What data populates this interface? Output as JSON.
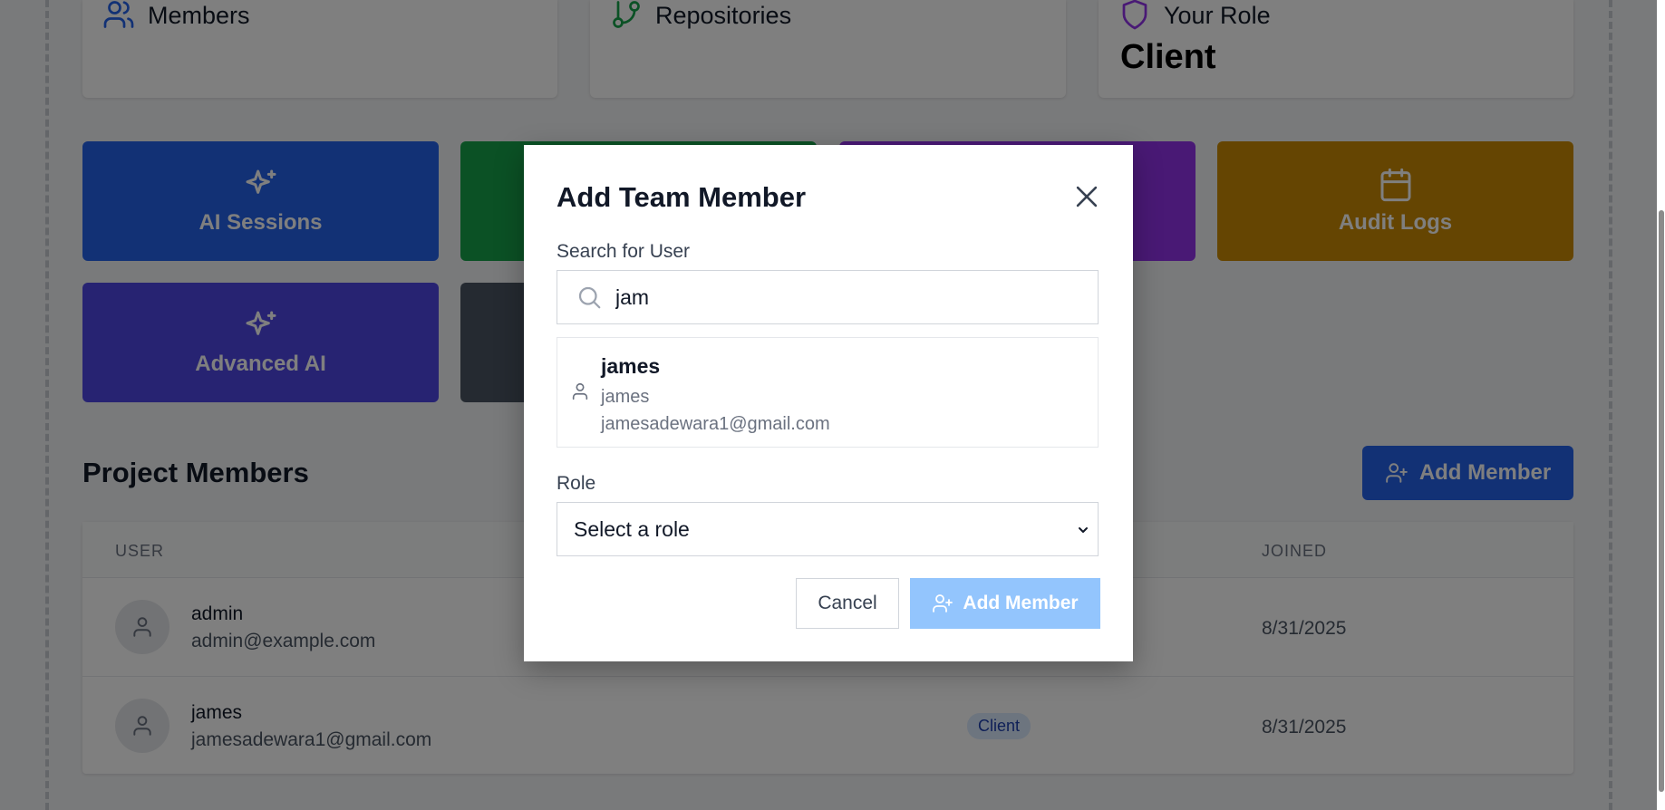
{
  "stats": [
    {
      "title": "Members",
      "icon": "users-icon",
      "value": ""
    },
    {
      "title": "Repositories",
      "icon": "git-branch-icon",
      "value": ""
    },
    {
      "title": "Your Role",
      "icon": "shield-icon",
      "value": "Client"
    }
  ],
  "actions": [
    {
      "label": "AI Sessions",
      "icon": "sparkles-icon",
      "color": "#2563eb"
    },
    {
      "label": "",
      "icon": "",
      "color": "#16a34a"
    },
    {
      "label": "",
      "icon": "",
      "color": "#9333ea"
    },
    {
      "label": "Audit Logs",
      "icon": "calendar-icon",
      "color": "#ca8a04"
    },
    {
      "label": "Advanced AI",
      "icon": "sparkles-icon",
      "color": "#4f46e5"
    },
    {
      "label": "",
      "icon": "",
      "color": "#4b5563"
    }
  ],
  "members_section": {
    "title": "Project Members",
    "add_button": "Add Member",
    "columns": {
      "user": "USER",
      "joined": "JOINED"
    },
    "rows": [
      {
        "name": "admin",
        "email": "admin@example.com",
        "role": "",
        "joined": "8/31/2025"
      },
      {
        "name": "james",
        "email": "jamesadewara1@gmail.com",
        "role": "Client",
        "joined": "8/31/2025"
      }
    ]
  },
  "modal": {
    "title": "Add Team Member",
    "search_label": "Search for User",
    "search_value": "jam",
    "result": {
      "name": "james",
      "username": "james",
      "email": "jamesadewara1@gmail.com"
    },
    "role_label": "Role",
    "role_value": "Select a role",
    "cancel": "Cancel",
    "submit": "Add Member"
  }
}
